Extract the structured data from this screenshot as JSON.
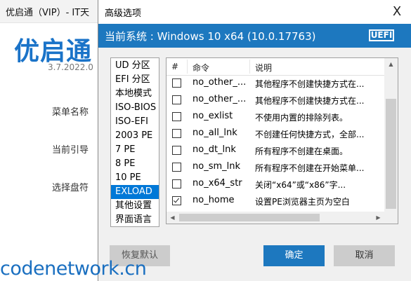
{
  "background_app": {
    "title": "优启通（VIP）- IT天",
    "logo_text": "优启通",
    "version": "3.7.2022.0",
    "labels": [
      "菜单名称",
      "当前引导",
      "选择盘符"
    ]
  },
  "dialog": {
    "title": "高级选项",
    "close_glyph": "X",
    "banner_text": "当前系统 : Windows 10 x64 (10.0.17763)",
    "badge": "UEFI"
  },
  "menu": {
    "items": [
      "UD 分区",
      "EFI 分区",
      "本地模式",
      "ISO-BIOS",
      "ISO-EFI",
      "2003 PE",
      "7 PE",
      "8 PE",
      "10 PE",
      "EXLOAD",
      "其他设置",
      "界面语言"
    ],
    "selected": "EXLOAD"
  },
  "table": {
    "headers": [
      "#",
      "命令",
      "说明"
    ],
    "rows": [
      {
        "checked": false,
        "command": "no_other_...",
        "description": "其他程序不创建快捷方式在..."
      },
      {
        "checked": false,
        "command": "no_other_...",
        "description": "其他程序不创建快捷方式在..."
      },
      {
        "checked": false,
        "command": "no_exlist",
        "description": "不使用内置的排除列表。"
      },
      {
        "checked": false,
        "command": "no_all_lnk",
        "description": "不创建任何快捷方式，全部..."
      },
      {
        "checked": false,
        "command": "no_dt_lnk",
        "description": "所有程序不创建在桌面。"
      },
      {
        "checked": false,
        "command": "no_sm_lnk",
        "description": "所有程序不创建在开始菜单..."
      },
      {
        "checked": false,
        "command": "no_x64_str",
        "description": "关闭“x64”或“x86”字..."
      },
      {
        "checked": true,
        "command": "no_home",
        "description": "设置PE浏览器主页为空白"
      }
    ]
  },
  "buttons": {
    "reset": "恢复默认",
    "ok": "确定",
    "cancel": "取消"
  },
  "watermark": "codenetwork.cn",
  "colors": {
    "accent": "#1d78bf",
    "selected": "#0078d7",
    "logo": "#1a73c8"
  }
}
